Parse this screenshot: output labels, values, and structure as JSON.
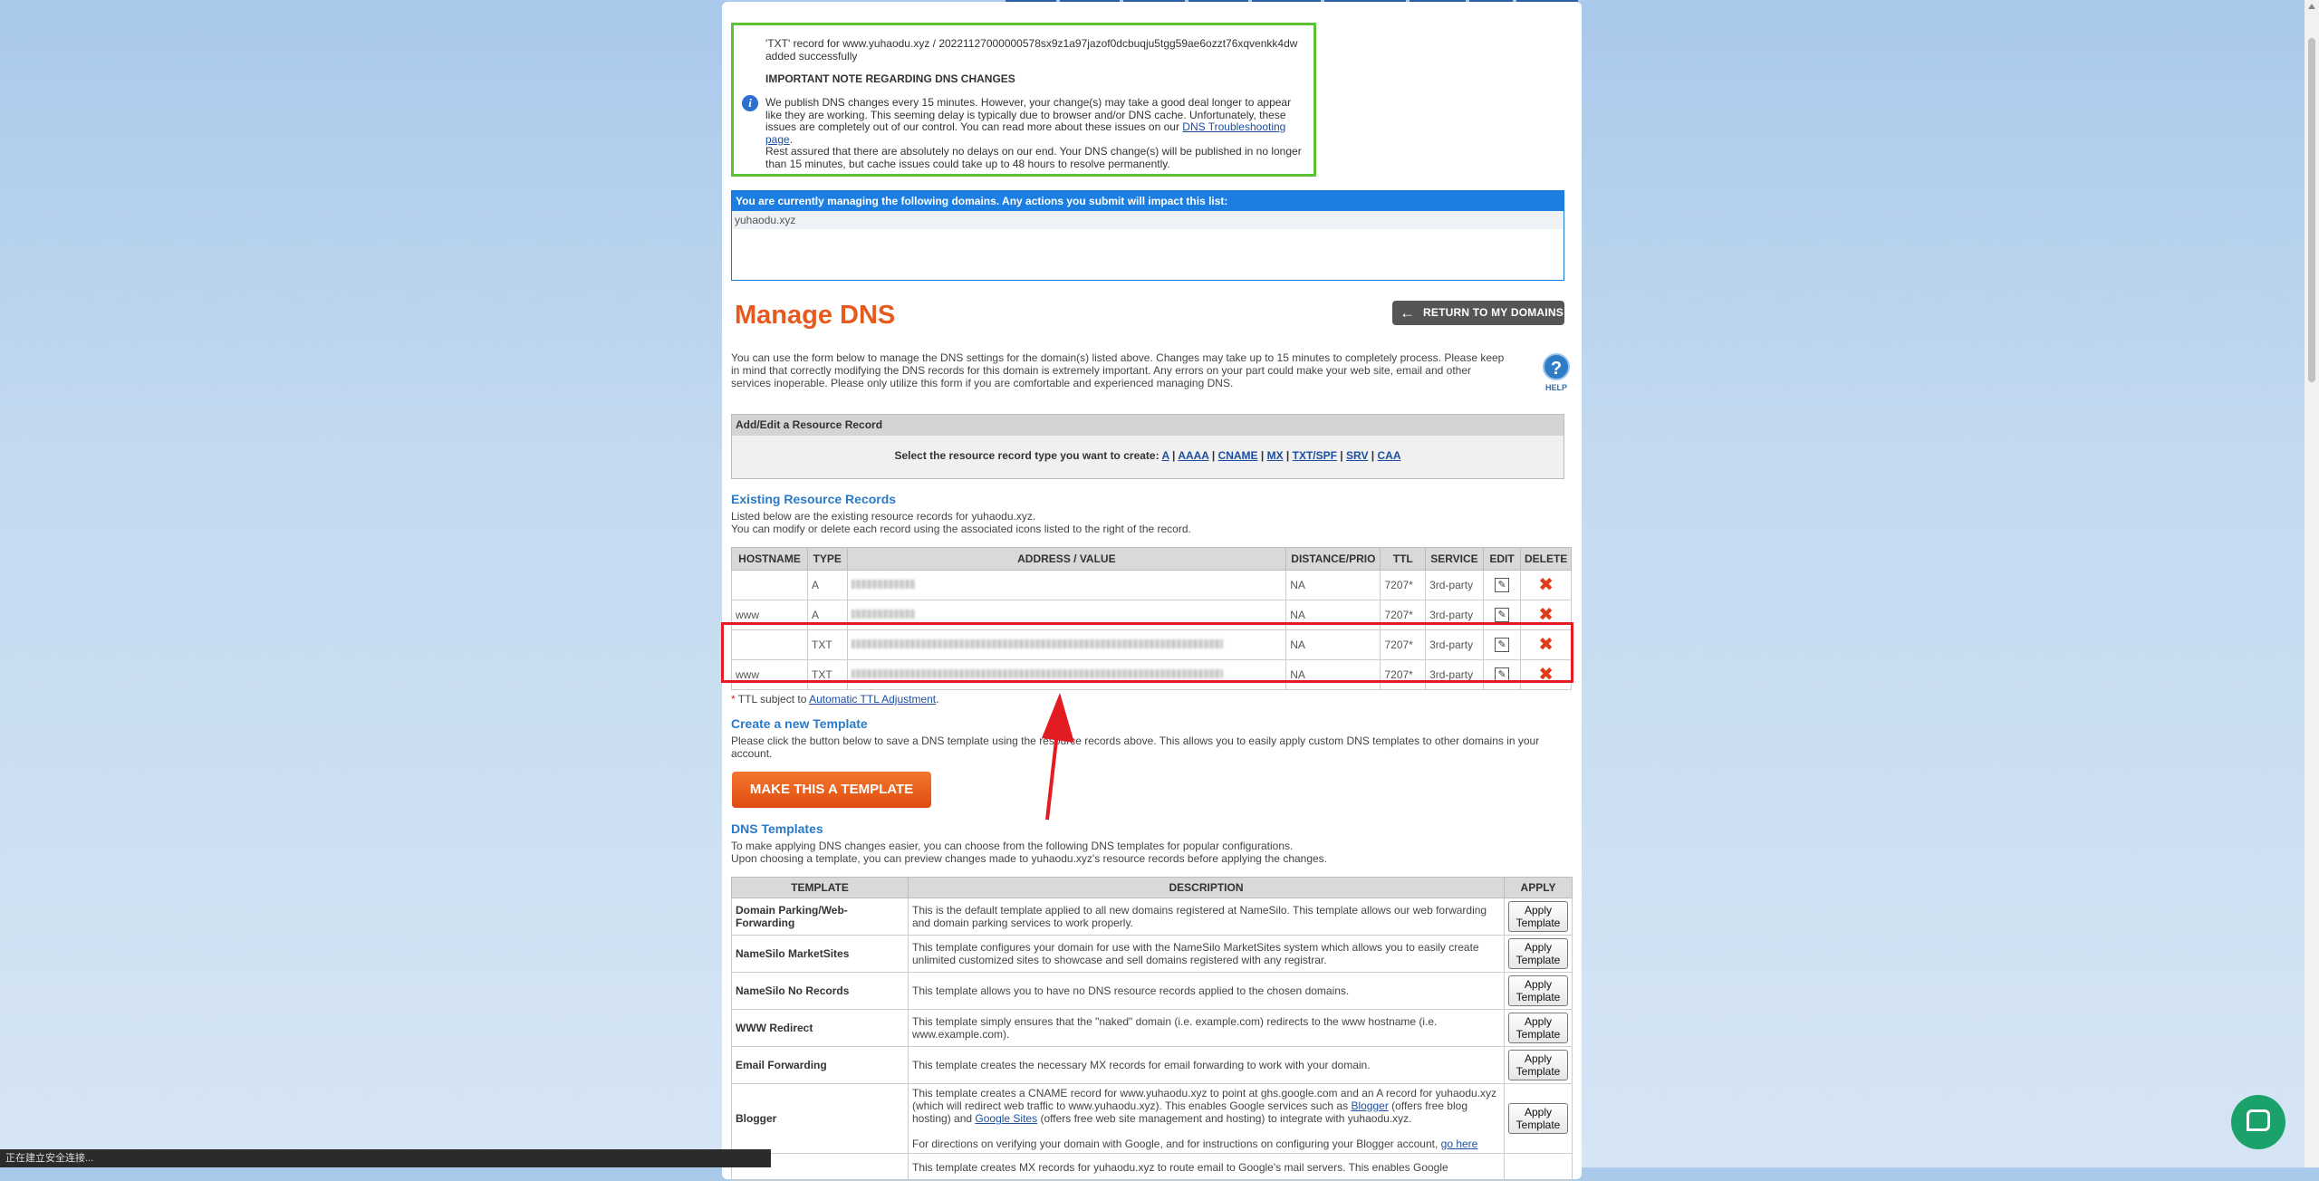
{
  "notice": {
    "line1": "'TXT' record for www.yuhaodu.xyz / 20221127000000578‌sx9z1a97jazof0dcbuqju5tgg59ae6ozzt76xqvenkk4dw",
    "line2": "added successfully",
    "heading": "IMPORTANT NOTE REGARDING DNS CHANGES",
    "p1": "We publish DNS changes every 15 minutes. However, your change(s) may take a good deal longer to appear like they are working. This seeming delay is typically due to browser and/or DNS cache. Unfortunately, these issues are completely out of our control. You can read more about these issues on our",
    "p1_link": "DNS Troubleshooting page",
    "p2": "Rest assured that there are absolutely no delays on our end. Your DNS change(s) will be published in no longer than 15 minutes, but cache issues could take up to 48 hours to resolve permanently."
  },
  "managing": {
    "header": "You are currently managing the following domains. Any actions you submit will impact this list:",
    "domain": "yuhaodu.xyz"
  },
  "title": "Manage DNS",
  "return_label": "RETURN TO MY DOMAINS",
  "intro": "You can use the form below to manage the DNS settings for the domain(s) listed above. Changes may take up to 15 minutes to completely process. Please keep in mind that correctly modifying the DNS records for this domain is extremely important. Any errors on your part could make your web site, email and other services inoperable. Please only utilize this form if you are comfortable and experienced managing DNS.",
  "help_label": "HELP",
  "add_edit": {
    "header": "Add/Edit a Resource Record",
    "select_text": "Select the resource record type you want to create:",
    "types": [
      "A",
      "AAAA",
      "CNAME",
      "MX",
      "TXT/SPF",
      "SRV",
      "CAA"
    ]
  },
  "existing": {
    "title": "Existing Resource Records",
    "line1": "Listed below are the existing resource records for yuhaodu.xyz.",
    "line2": "You can modify or delete each record using the associated icons listed to the right of the record.",
    "headers": [
      "HOSTNAME",
      "TYPE",
      "ADDRESS / VALUE",
      "DISTANCE/PRIO",
      "TTL",
      "SERVICE",
      "EDIT",
      "DELETE"
    ],
    "rows": [
      {
        "host": "",
        "type": "A",
        "dist": "NA",
        "ttl": "7207*",
        "service": "3rd-party"
      },
      {
        "host": "www",
        "type": "A",
        "dist": "NA",
        "ttl": "7207*",
        "service": "3rd-party"
      },
      {
        "host": "",
        "type": "TXT",
        "dist": "NA",
        "ttl": "7207*",
        "service": "3rd-party"
      },
      {
        "host": "www",
        "type": "TXT",
        "dist": "NA",
        "ttl": "7207*",
        "service": "3rd-party"
      }
    ],
    "ttl_note": "TTL subject to",
    "ttl_link": "Automatic TTL Adjustment"
  },
  "create_template": {
    "title": "Create a new Template",
    "text": "Please click the button below to save a DNS template using the resource records above. This allows you to easily apply custom DNS templates to other domains in your account.",
    "button": "MAKE THIS A TEMPLATE"
  },
  "dns_templates": {
    "title": "DNS Templates",
    "line1": "To make applying DNS changes easier, you can choose from the following DNS templates for popular configurations.",
    "line2": "Upon choosing a template, you can preview changes made to yuhaodu.xyz's resource records before applying the changes.",
    "headers": [
      "TEMPLATE",
      "DESCRIPTION",
      "APPLY"
    ],
    "apply_label": "Apply Template",
    "rows": [
      {
        "name": "Domain Parking/Web-Forwarding",
        "desc": "This is the default template applied to all new domains registered at NameSilo. This template allows our web forwarding and domain parking services to work properly."
      },
      {
        "name": "NameSilo MarketSites",
        "desc": "This template configures your domain for use with the NameSilo MarketSites system which allows you to easily create unlimited customized sites to showcase and sell domains registered with any registrar."
      },
      {
        "name": "NameSilo No Records",
        "desc": "This template allows you to have no DNS resource records applied to the chosen domains."
      },
      {
        "name": "WWW Redirect",
        "desc": "This template simply ensures that the \"naked\" domain (i.e. example.com) redirects to the www hostname (i.e. www.example.com)."
      },
      {
        "name": "Email Forwarding",
        "desc": "This template creates the necessary MX records for email forwarding to work with your domain."
      }
    ],
    "blogger": {
      "name": "Blogger",
      "desc1": "This template creates a CNAME record for www.yuhaodu.xyz to point at ghs.google.com and an A record for yuhaodu.xyz (which will redirect web traffic to www.yuhaodu.xyz). This enables Google services such as",
      "link1": "Blogger",
      "mid1": "(offers free blog hosting) and",
      "link2": "Google Sites",
      "mid2": "(offers free web site management and hosting) to integrate with yuhaodu.xyz.",
      "desc2": "For directions on verifying your domain with Google, and for instructions on configuring your Blogger account,",
      "link3": "go here"
    },
    "partial": "This template creates MX records for yuhaodu.xyz to route email to Google's mail servers. This enables Google"
  },
  "status_bar": "正在建立安全连接..."
}
